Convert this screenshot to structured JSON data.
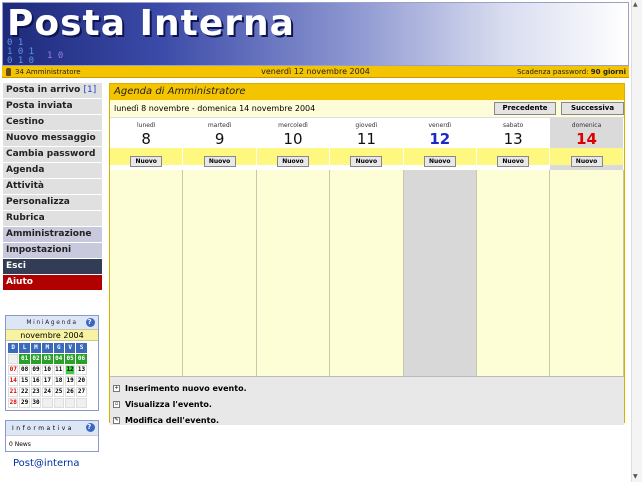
{
  "banner": {
    "title": "Posta Interna"
  },
  "infobar": {
    "user": "34 Amministratore",
    "date": "venerdì 12 novembre 2004",
    "pwd_label": "Scadenza password:",
    "pwd_value": "90 giorni"
  },
  "sidebar": {
    "items": [
      {
        "label": "Posta in arrivo",
        "count": "[1]"
      },
      {
        "label": "Posta inviata"
      },
      {
        "label": "Cestino"
      },
      {
        "label": "Nuovo messaggio"
      },
      {
        "label": "Cambia password"
      },
      {
        "label": "Agenda"
      },
      {
        "label": "Attività"
      },
      {
        "label": "Personalizza"
      },
      {
        "label": "Rubrica"
      },
      {
        "label": "Amministrazione"
      },
      {
        "label": "Impostazioni"
      },
      {
        "label": "Esci"
      },
      {
        "label": "Aiuto"
      }
    ]
  },
  "mini": {
    "title": "MiniAgenda",
    "month": "novembre 2004",
    "days": [
      "D",
      "L",
      "M",
      "M",
      "G",
      "V",
      "S"
    ],
    "weeks": [
      [
        "",
        "01",
        "02",
        "03",
        "04",
        "05",
        "06"
      ],
      [
        "07",
        "08",
        "09",
        "10",
        "11",
        "12",
        "13"
      ],
      [
        "14",
        "15",
        "16",
        "17",
        "18",
        "19",
        "20"
      ],
      [
        "21",
        "22",
        "23",
        "24",
        "25",
        "26",
        "27"
      ],
      [
        "28",
        "29",
        "30",
        "",
        "",
        "",
        ""
      ]
    ]
  },
  "info": {
    "title": "Informativa",
    "news": "0 News"
  },
  "footer": {
    "logo": "Post@interna"
  },
  "agenda": {
    "title": "Agenda di Amministratore",
    "range": "lunedì 8 novembre - domenica 14 novembre 2004",
    "prev": "Precedente",
    "next": "Successiva",
    "new_label": "Nuovo",
    "days": [
      {
        "name": "lunedì",
        "num": "8"
      },
      {
        "name": "martedì",
        "num": "9"
      },
      {
        "name": "mercoledì",
        "num": "10"
      },
      {
        "name": "giovedì",
        "num": "11"
      },
      {
        "name": "venerdì",
        "num": "12"
      },
      {
        "name": "sabato",
        "num": "13"
      },
      {
        "name": "domenica",
        "num": "14"
      }
    ],
    "legend": [
      "Inserimento nuovo evento.",
      "Visualizza l'evento.",
      "Modifica dell'evento."
    ]
  }
}
